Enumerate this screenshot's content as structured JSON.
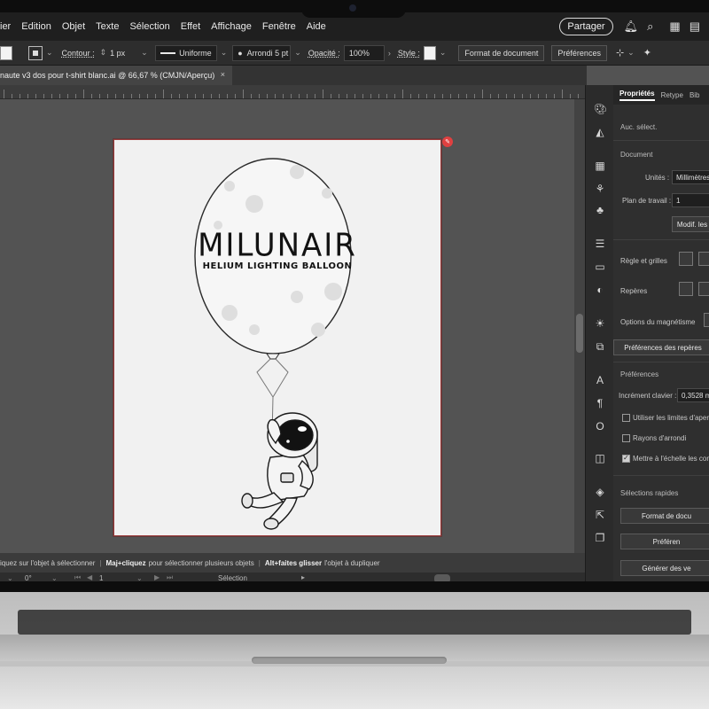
{
  "menubar": {
    "items": [
      "ier",
      "Edition",
      "Objet",
      "Texte",
      "Sélection",
      "Effet",
      "Affichage",
      "Fenêtre",
      "Aide"
    ],
    "share_label": "Partager"
  },
  "controlbar": {
    "contour_label": "Contour :",
    "stroke_width": "1 px",
    "profile": "Uniforme",
    "brush": "Arrondi 5 pt",
    "opacity_label": "Opacité :",
    "opacity_value": "100%",
    "style_label": "Style :",
    "format_button": "Format de document",
    "prefs_button": "Préférences"
  },
  "document_tab": {
    "title": "naute v3 dos pour t-shirt blanc.ai @ 66,67 % (CMJN/Aperçu)",
    "close_symbol": "×"
  },
  "artwork": {
    "brand": "MILUNAIR",
    "tagline": "HELIUM LIGHTING BALLOON"
  },
  "statusbar": {
    "part1": "iquez sur l'objet à sélectionner",
    "shortcut2": "Maj+cliquez",
    "part2": "pour sélectionner plusieurs objets",
    "shortcut3": "Alt+faites glisser",
    "part3": "l'objet à dupliquer"
  },
  "bottombar": {
    "rotation": "0°",
    "artboard_number": "1",
    "tool_name": "Sélection"
  },
  "panel": {
    "tabs": [
      "Propriétés",
      "Retype",
      "Bib"
    ],
    "no_selection": "Auc. sélect.",
    "document_head": "Document",
    "units_label": "Unités :",
    "units_value": "Millimètres",
    "artboard_label": "Plan de travail :",
    "artboard_value": "1",
    "edit_artboards_button": "Modif. les",
    "rulers_grids_label": "Règle et grilles",
    "guides_label": "Repères",
    "snap_options_label": "Options du magnétisme",
    "guide_prefs_button": "Préférences des repères",
    "preferences_head": "Préférences",
    "keyboard_increment_label": "Incrément clavier :",
    "keyboard_increment_value": "0,3528 mi",
    "use_preview_bounds": "Utiliser les limites d'aperçu",
    "rounded_corners": "Rayons d'arrondi",
    "scale_strokes": "Mettre à l'échelle les conto",
    "quick_actions_head": "Sélections rapides",
    "quick_format_button": "Format de docu",
    "quick_prefs_button": "Préféren",
    "quick_generate_button": "Générer des ve"
  },
  "colors": {
    "artboard_bg": "#f1f1f1",
    "app_dark": "#2f2f2f",
    "canvas": "#535353",
    "accent_red": "#e04040"
  }
}
